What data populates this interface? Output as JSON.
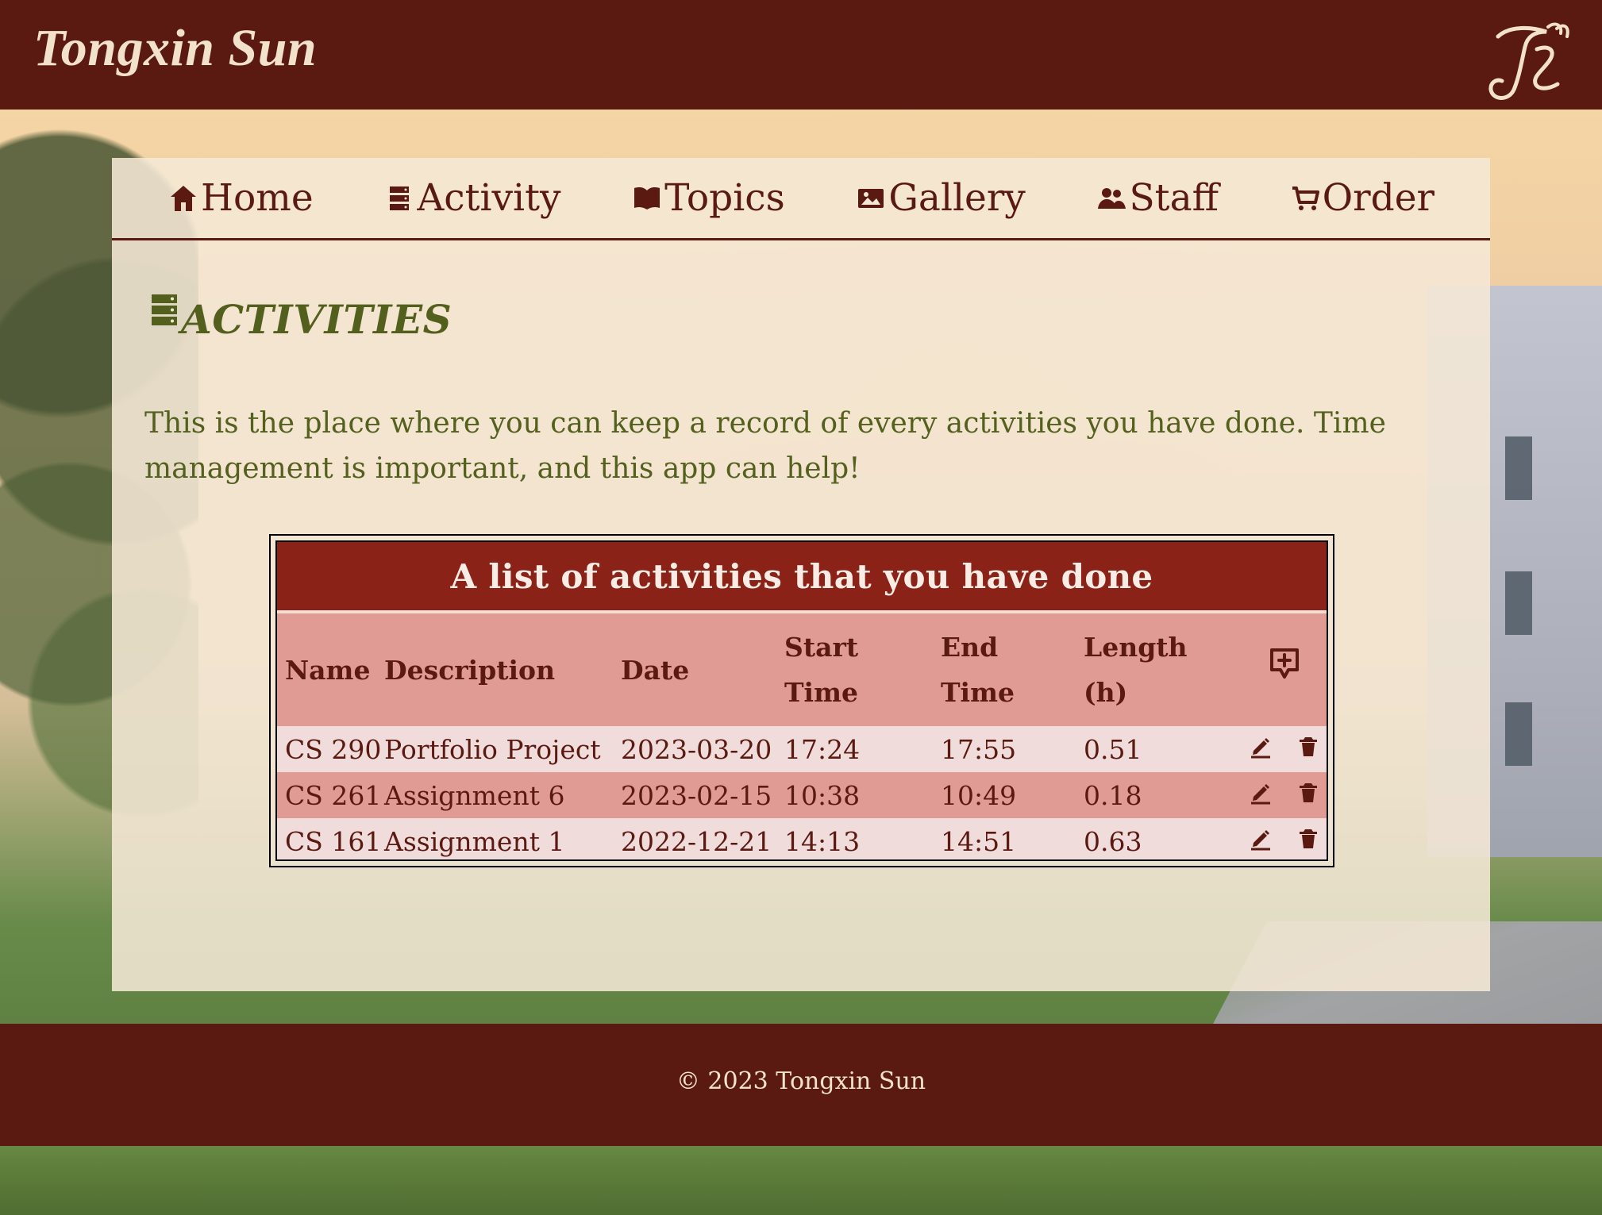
{
  "header": {
    "site_title": "Tongxin Sun"
  },
  "navigation": [
    {
      "label": "Home",
      "icon": "home-icon"
    },
    {
      "label": "Activity",
      "icon": "server-icon"
    },
    {
      "label": "Topics",
      "icon": "book-open-icon"
    },
    {
      "label": "Gallery",
      "icon": "image-icon"
    },
    {
      "label": "Staff",
      "icon": "users-icon"
    },
    {
      "label": "Order",
      "icon": "cart-icon"
    }
  ],
  "page": {
    "heading_icon": "server-icon",
    "title": "ACTIVITIES",
    "intro": "This is the place where you can keep a record of every activities you have done. Time management is important, and this app can help!"
  },
  "activity_table": {
    "caption": "A list of activities that you have done",
    "columns": [
      "Name",
      "Description",
      "Date",
      "Start Time",
      "End Time",
      "Length (h)"
    ],
    "add_icon": "add-comment-icon",
    "rows": [
      {
        "name": "CS 290",
        "description": "Portfolio Project",
        "date": "2023-03-20",
        "start_time": "17:24",
        "end_time": "17:55",
        "length": "0.51"
      },
      {
        "name": "CS 261",
        "description": "Assignment 6",
        "date": "2023-02-15",
        "start_time": "10:38",
        "end_time": "10:49",
        "length": "0.18"
      },
      {
        "name": "CS 161",
        "description": "Assignment 1",
        "date": "2022-12-21",
        "start_time": "14:13",
        "end_time": "14:51",
        "length": "0.63"
      }
    ],
    "row_action_icons": [
      "edit-icon",
      "trash-icon"
    ]
  },
  "footer": {
    "copyright": "© 2023 Tongxin Sun"
  },
  "colors": {
    "primary_dark": "#5a1a12",
    "accent_green": "#54611e",
    "table_header": "#8b2218",
    "table_stripe": "#df9b94"
  }
}
